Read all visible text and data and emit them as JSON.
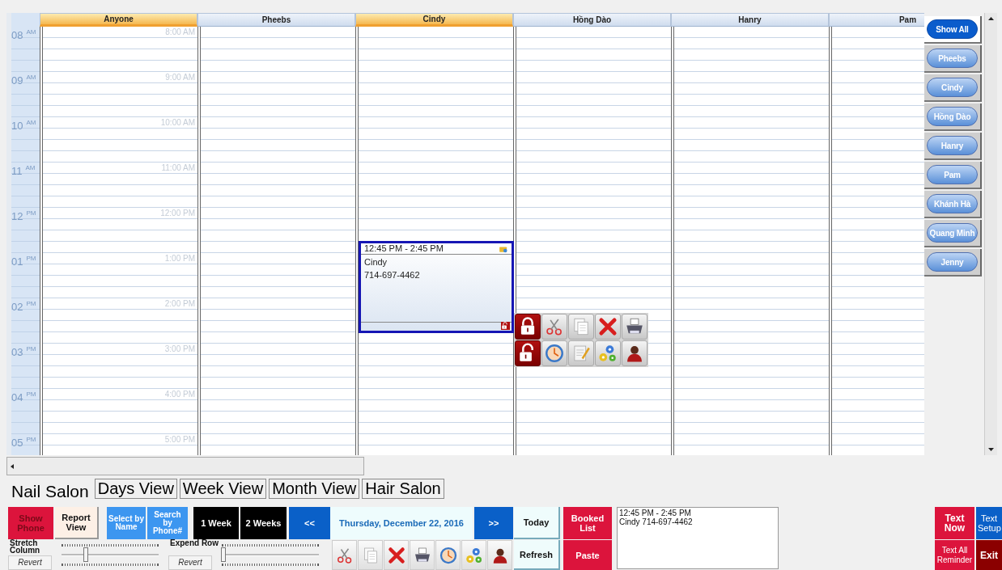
{
  "calendar": {
    "columns": [
      {
        "name": "Anyone",
        "highlighted": true
      },
      {
        "name": "Pheebs",
        "highlighted": false
      },
      {
        "name": "Cindy",
        "highlighted": true,
        "appointments": [
          {
            "time": "12:45 PM - 2:45 PM",
            "name": "Cindy",
            "phone": "714-697-4462",
            "selected": true
          }
        ]
      },
      {
        "name": "Hồng Dào",
        "highlighted": false
      },
      {
        "name": "Hanry",
        "highlighted": false
      },
      {
        "name": "Pam",
        "highlighted": false
      }
    ],
    "hours": [
      {
        "hour": "08",
        "period": "AM",
        "label": "8:00 AM"
      },
      {
        "hour": "09",
        "period": "AM",
        "label": "9:00 AM"
      },
      {
        "hour": "10",
        "period": "AM",
        "label": "10:00 AM"
      },
      {
        "hour": "11",
        "period": "AM",
        "label": "11:00 AM"
      },
      {
        "hour": "12",
        "period": "PM",
        "label": "12:00 PM"
      },
      {
        "hour": "01",
        "period": "PM",
        "label": "1:00 PM"
      },
      {
        "hour": "02",
        "period": "PM",
        "label": "2:00 PM"
      },
      {
        "hour": "03",
        "period": "PM",
        "label": "3:00 PM"
      },
      {
        "hour": "04",
        "period": "PM",
        "label": "4:00 PM"
      },
      {
        "hour": "05",
        "period": "PM",
        "label": "5:00 PM"
      }
    ]
  },
  "staff_filter": [
    {
      "label": "Show All",
      "selected": true
    },
    {
      "label": "Pheebs",
      "selected": false
    },
    {
      "label": "Cindy",
      "selected": false
    },
    {
      "label": "Hồng Dào",
      "selected": false
    },
    {
      "label": "Hanry",
      "selected": false
    },
    {
      "label": "Pam",
      "selected": false
    },
    {
      "label": "Khánh Hà",
      "selected": false
    },
    {
      "label": "Quang Minh",
      "selected": false
    },
    {
      "label": "Jenny",
      "selected": false
    }
  ],
  "view_tabs": [
    {
      "label": "Nail Salon",
      "selected": true
    },
    {
      "label": "Days View",
      "selected": false
    },
    {
      "label": "Week View",
      "selected": false
    },
    {
      "label": "Month View",
      "selected": false
    },
    {
      "label": "Hair Salon",
      "selected": false
    }
  ],
  "controls": {
    "show_phone": "Show Phone",
    "report_view": "Report View",
    "select_by_name": "Select by Name",
    "search_by_phone": "Search by Phone#",
    "range_buttons": [
      "1 Week",
      "2 Weeks"
    ],
    "prev": "<<",
    "date": "Thursday, December 22, 2016",
    "next": ">>",
    "today": "Today",
    "refresh": "Refresh",
    "booked_list": "Booked List",
    "paste": "Paste",
    "notes": "12:45 PM - 2:45 PM\nCindy 714-697-4462",
    "stretch_column": {
      "label": "Stretch Column",
      "level": 0.25,
      "revert": "Revert"
    },
    "expand_row": {
      "label": "Expend Row",
      "level": 0.02,
      "revert": "Revert"
    },
    "text_now": "Text Now",
    "text_setup": "Text Setup",
    "text_all_reminder": "Text All Reminder",
    "exit": "Exit"
  }
}
